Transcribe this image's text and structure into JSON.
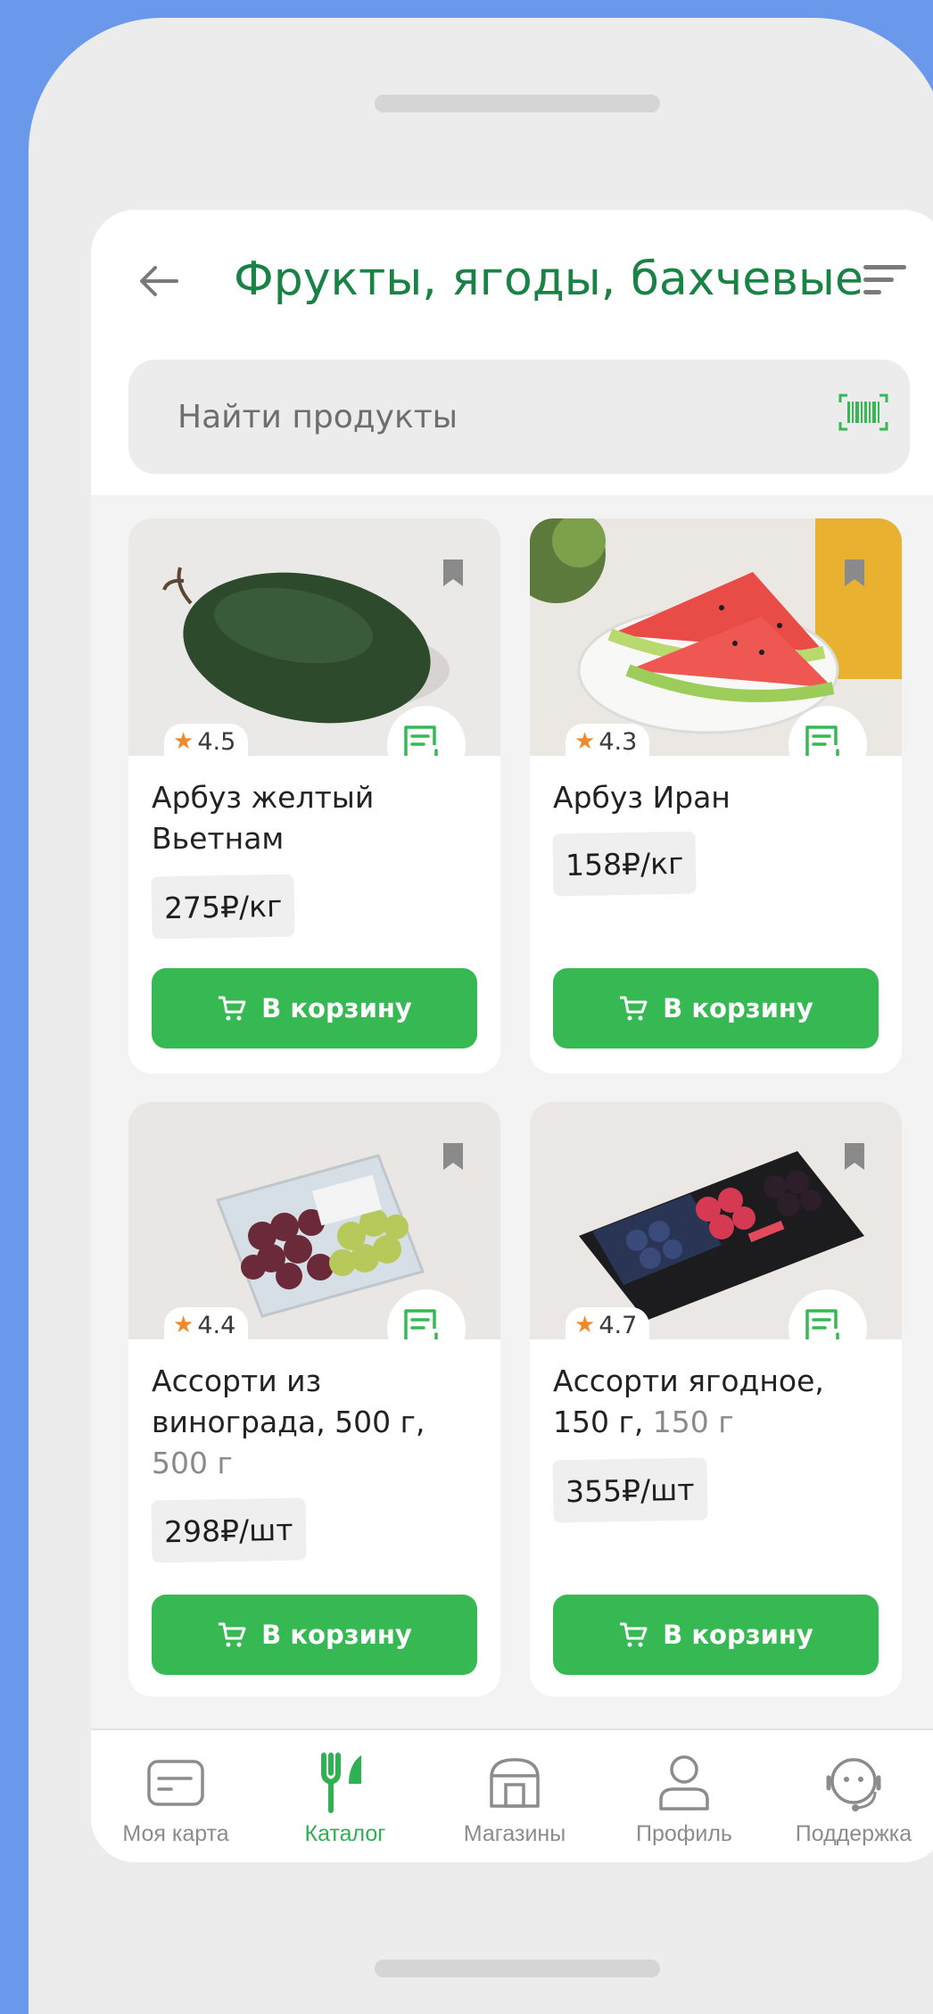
{
  "header": {
    "title": "Фрукты, ягоды, бахчевые",
    "back_icon": "arrow-left-icon",
    "sort_icon": "sort-icon"
  },
  "search": {
    "placeholder": "Найти продукты",
    "barcode_icon": "barcode-scan-icon"
  },
  "products": [
    {
      "name": "Арбуз желтый Вьетнам",
      "weight": "",
      "rating": "4.5",
      "price": "275₽/кг",
      "cart_label": "В корзину"
    },
    {
      "name": "Арбуз Иран",
      "weight": "",
      "rating": "4.3",
      "price": "158₽/кг",
      "cart_label": "В корзину"
    },
    {
      "name": "Ассорти из винограда, 500 г, ",
      "weight": "500 г",
      "rating": "4.4",
      "price": "298₽/шт",
      "cart_label": "В корзину"
    },
    {
      "name": "Ассорти ягодное, 150 г, ",
      "weight": "150 г",
      "rating": "4.7",
      "price": "355₽/шт",
      "cart_label": "В корзину"
    }
  ],
  "bottom_nav": [
    {
      "label": "Моя карта",
      "icon": "card-icon",
      "active": false
    },
    {
      "label": "Каталог",
      "icon": "fork-knife-icon",
      "active": true
    },
    {
      "label": "Магазины",
      "icon": "store-icon",
      "active": false
    },
    {
      "label": "Профиль",
      "icon": "profile-icon",
      "active": false
    },
    {
      "label": "Поддержка",
      "icon": "support-icon",
      "active": false
    }
  ],
  "colors": {
    "brand_green": "#36b953",
    "title_green": "#198346",
    "star_orange": "#ed8a2c",
    "background_blue": "#6a99ec"
  }
}
